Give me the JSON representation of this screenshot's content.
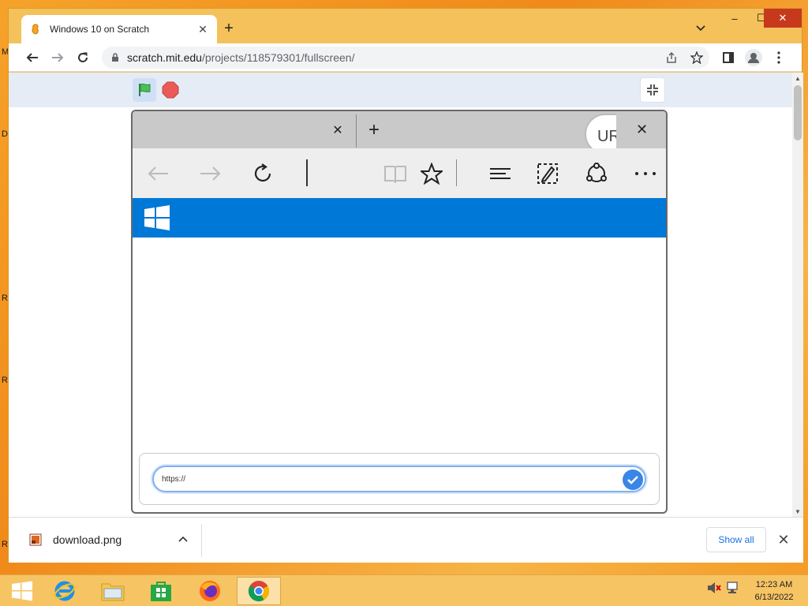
{
  "desktop": {
    "edge_labels": [
      "M",
      "D",
      "R",
      "R",
      "R"
    ]
  },
  "browser": {
    "tab": {
      "title": "Windows 10 on Scratch",
      "favicon": "scratch-cat-icon"
    },
    "new_tab_symbol": "+",
    "window_controls": {
      "minimize": "–",
      "maximize": "☐",
      "close": "✕"
    },
    "url": {
      "host": "scratch.mit.edu",
      "path": "/projects/118579301/fullscreen/"
    }
  },
  "scratch": {
    "buttons": [
      "green-flag",
      "stop",
      "exit-fullscreen"
    ]
  },
  "edge_sim": {
    "tab_close": "✕",
    "new_tab": "+",
    "speech_bubble": "UR",
    "close": "✕",
    "banner_color": "#0078d7",
    "url_input_value": "https://"
  },
  "downloads": {
    "file_name": "download.png",
    "show_all": "Show all",
    "close": "✕"
  },
  "taskbar": {
    "pinned": [
      "start",
      "internet-explorer",
      "file-explorer",
      "store",
      "firefox",
      "chrome"
    ],
    "active": "chrome",
    "time": "12:23 AM",
    "date": "6/13/2022"
  },
  "colors": {
    "accent": "#1a73e8",
    "desktop": "#f6a22a",
    "edge_blue": "#0078d7"
  }
}
